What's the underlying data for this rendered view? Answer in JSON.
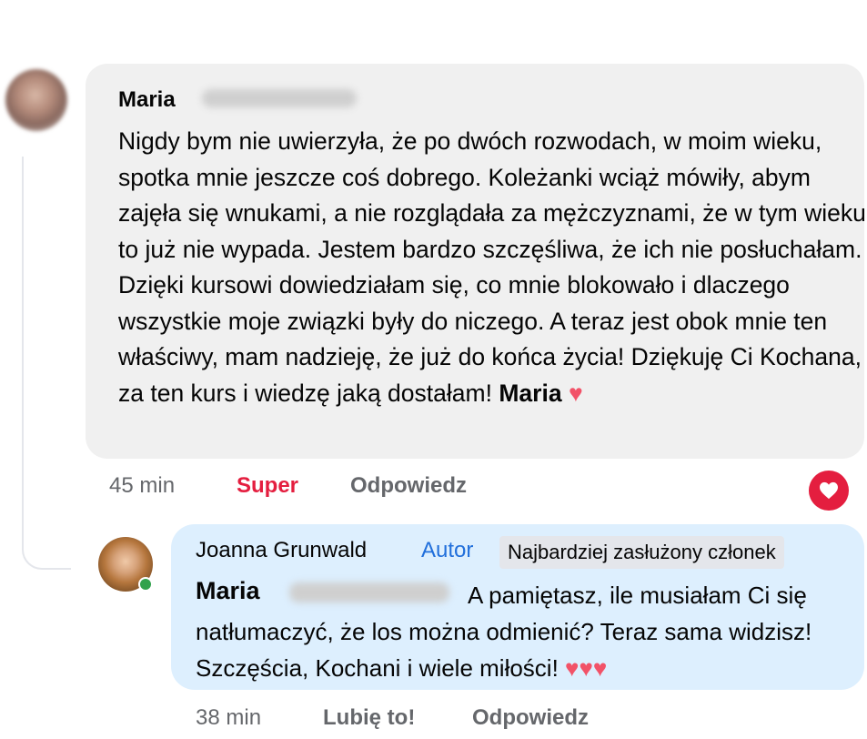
{
  "comment": {
    "author_first": "Maria",
    "text": "Nigdy bym nie uwierzyła, że po dwóch rozwodach, w moim wieku, spotka mnie jeszcze coś dobrego. Koleżanki wciąż mówiły, abym zajęła się wnukami, a nie rozglądała za mężczyznami, że w tym wieku to już nie wypada. Jestem bardzo szczęśliwa, że ich nie posłuchałam. Dzięki kursowi dowiedziałam się, co mnie blokowało i dlaczego wszystkie moje związki były do niczego. A teraz jest obok mnie ten właściwy, mam nadzieję, że już do końca życia! Dziękuję Ci Kochana, za ten kurs i wiedzę jaką dostałam!",
    "signature": "Maria",
    "emoji": "♥",
    "time": "45 min",
    "reaction_label": "Super",
    "reply_label": "Odpowiedz",
    "reaction_icon": "heart-icon"
  },
  "reply": {
    "author": "Joanna Grunwald",
    "author_badge": "Autor",
    "member_badge": "Najbardziej zasłużony członek",
    "mention_first": "Maria",
    "text_first_line": "A pamiętasz, ile musiałam Ci się",
    "text_rest": "natłumaczyć, że los można odmienić? Teraz sama widzisz! Szczęścia, Kochani i wiele miłości!",
    "emoji": "♥♥♥",
    "time": "38 min",
    "like_label": "Lubię to!",
    "reply_label": "Odpowiedz"
  },
  "colors": {
    "comment_bubble": "#f0f0f0",
    "reply_bubble": "#ddeffe",
    "accent_red": "#e41e3f",
    "author_blue": "#216fdb",
    "muted": "#65676b",
    "online_green": "#31a24c"
  }
}
